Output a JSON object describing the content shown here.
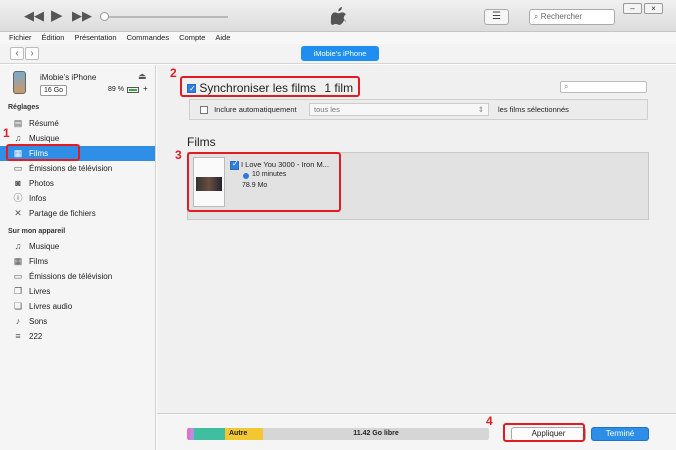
{
  "player": {
    "search_placeholder": "Rechercher"
  },
  "menu": [
    "Fichier",
    "Édition",
    "Présentation",
    "Commandes",
    "Compte",
    "Aide"
  ],
  "nav": {
    "device_pill": "iMobie’s iPhone"
  },
  "device": {
    "name": "iMobie’s iPhone",
    "capacity": "16 Go",
    "battery": "89 %"
  },
  "sidebar": {
    "section_settings": "Réglages",
    "settings_items": [
      {
        "label": "Résumé",
        "icon": "summary-icon"
      },
      {
        "label": "Musique",
        "icon": "music-icon"
      },
      {
        "label": "Films",
        "icon": "film-icon"
      },
      {
        "label": "Émissions de télévision",
        "icon": "tv-icon"
      },
      {
        "label": "Photos",
        "icon": "camera-icon"
      },
      {
        "label": "Infos",
        "icon": "info-icon"
      },
      {
        "label": "Partage de fichiers",
        "icon": "file-sharing-icon"
      }
    ],
    "section_device": "Sur mon appareil",
    "device_items": [
      {
        "label": "Musique",
        "icon": "music-icon"
      },
      {
        "label": "Films",
        "icon": "film-icon"
      },
      {
        "label": "Émissions de télévision",
        "icon": "tv-icon"
      },
      {
        "label": "Livres",
        "icon": "book-icon"
      },
      {
        "label": "Livres audio",
        "icon": "audiobook-icon"
      },
      {
        "label": "Sons",
        "icon": "bell-icon"
      },
      {
        "label": "222",
        "icon": "playlist-icon"
      }
    ]
  },
  "main": {
    "sync_label": "Synchroniser les films",
    "sync_count": "1 film",
    "sync_checked": true,
    "include_label": "Inclure automatiquement",
    "include_select": "tous les",
    "include_suffix": "les films sélectionnés",
    "films_heading": "Films",
    "movie": {
      "title": "I Love You 3000 - Iron M...",
      "duration": "10 minutes",
      "size": "78.9 Mo",
      "checked": true
    }
  },
  "storage": {
    "other_label": "Autre",
    "free_label": "11.42 Go libre"
  },
  "buttons": {
    "apply": "Appliquer",
    "done": "Terminé"
  },
  "annotations": [
    "1",
    "2",
    "3",
    "4"
  ],
  "colors": {
    "accent": "#2f8ee6",
    "annotation": "#e31b23"
  }
}
